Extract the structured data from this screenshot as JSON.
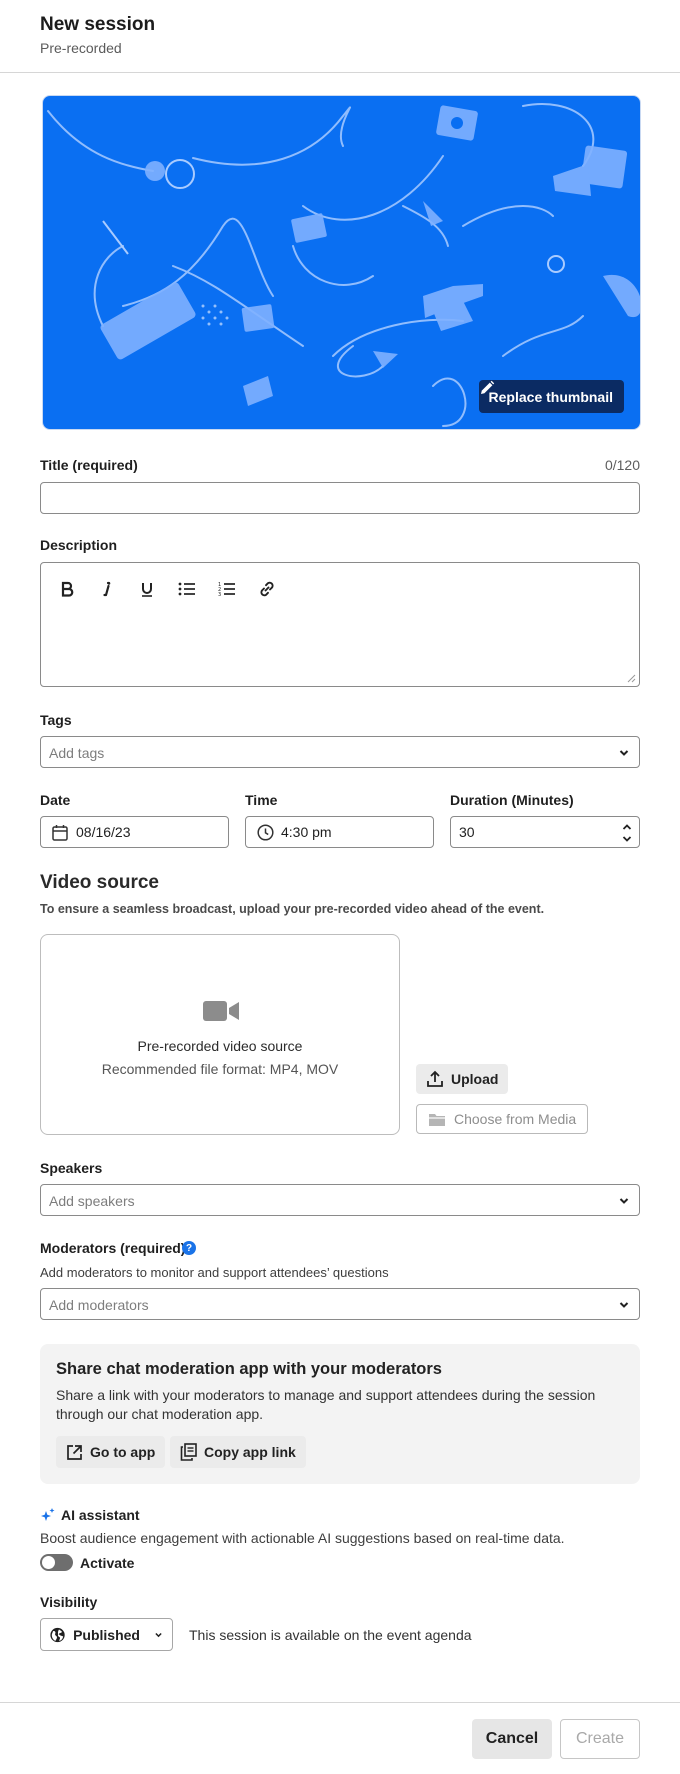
{
  "header": {
    "title": "New session",
    "subtitle": "Pre-recorded"
  },
  "thumbnail": {
    "replace_label": "Replace thumbnail",
    "bg_color": "#0a6ff2"
  },
  "title_field": {
    "label": "Title (required)",
    "counter": "0/120",
    "value": ""
  },
  "description": {
    "label": "Description",
    "tools": [
      "bold-icon",
      "italic-icon",
      "underline-icon",
      "bullet-list-icon",
      "numbered-list-icon",
      "link-icon"
    ]
  },
  "tags": {
    "label": "Tags",
    "placeholder": "Add tags"
  },
  "schedule": {
    "date_label": "Date",
    "date_value": "08/16/23",
    "time_label": "Time",
    "time_value": "4:30 pm",
    "duration_label": "Duration (Minutes)",
    "duration_value": "30"
  },
  "video_source": {
    "heading": "Video source",
    "subtext": "To ensure a seamless broadcast, upload your pre-recorded video ahead of the event.",
    "drop_title": "Pre-recorded video source",
    "drop_formats": "Recommended file format: MP4, MOV",
    "upload_label": "Upload",
    "choose_label": "Choose from Media"
  },
  "speakers": {
    "label": "Speakers",
    "placeholder": "Add speakers"
  },
  "moderators": {
    "label": "Moderators (required)",
    "help": "?",
    "subtext": "Add moderators to monitor and support attendees’ questions",
    "placeholder": "Add moderators"
  },
  "share_box": {
    "heading": "Share chat moderation app with your moderators",
    "body": "Share a link with your moderators to manage and support attendees during the session through our chat moderation app.",
    "go_label": "Go to app",
    "copy_label": "Copy app link"
  },
  "ai_assistant": {
    "label": "AI assistant",
    "subtext": "Boost audience engagement with actionable AI suggestions based on real-time data.",
    "toggle_label": "Activate",
    "enabled": false,
    "accent": "#1a73e8"
  },
  "visibility": {
    "label": "Visibility",
    "selected": "Published",
    "description": "This session is available on the event agenda"
  },
  "footer": {
    "cancel_label": "Cancel",
    "create_label": "Create"
  }
}
